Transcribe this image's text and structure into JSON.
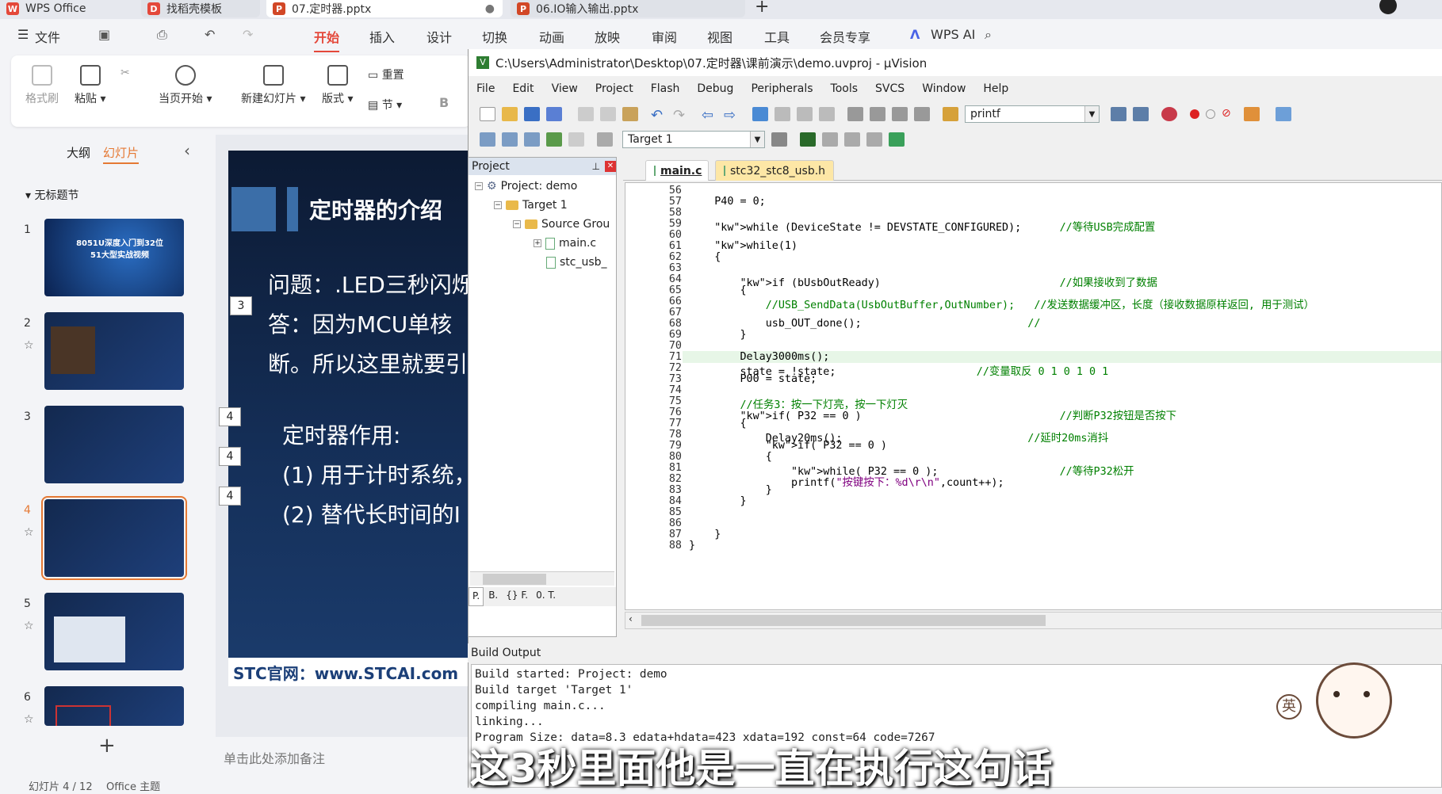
{
  "wps": {
    "tabs": [
      {
        "label": "WPS Office",
        "icon": "wps-logo-icon",
        "color": "#e4483a"
      },
      {
        "label": "找稻壳模板",
        "icon": "docer-icon",
        "color": "#e4483a"
      },
      {
        "label": "07.定时器.pptx",
        "icon": "ppt-file-icon",
        "color": "#d24726"
      },
      {
        "label": "06.IO输入输出.pptx",
        "icon": "ppt-file-icon",
        "color": "#d24726"
      }
    ],
    "menu": {
      "file": "文件",
      "tabs": [
        "开始",
        "插入",
        "设计",
        "切换",
        "动画",
        "放映",
        "审阅",
        "视图",
        "工具",
        "会员专享"
      ],
      "active_tab": "开始",
      "wps_ai": "WPS AI"
    },
    "ribbon": {
      "format_painter": "格式刷",
      "paste": "粘贴",
      "from_current": "当页开始",
      "new_slide": "新建幻灯片",
      "layout": "版式",
      "reset": "重置",
      "section": "节",
      "bold": "B"
    },
    "panel": {
      "outline_tab": "大纲",
      "slides_tab": "幻灯片",
      "section_title": "无标题节",
      "thumb1_title": "8051U深度入门到32位\n51大型实战视频",
      "thumbs": [
        {
          "num": "1",
          "star": false
        },
        {
          "num": "2",
          "star": true
        },
        {
          "num": "3",
          "star": false
        },
        {
          "num": "4",
          "star": true,
          "selected": true
        },
        {
          "num": "5",
          "star": true
        },
        {
          "num": "6",
          "star": true
        }
      ],
      "add_label": "+"
    },
    "slide": {
      "title": "定时器的介绍",
      "q_line": "问题：.LED三秒闪烁",
      "a_line1": "答：因为MCU单核",
      "a_line2": "断。所以这里就要引",
      "role_title": "定时器作用:",
      "role1": "(1) 用于计时系统，",
      "role2": "(2) 替代长时间的I",
      "footer": "STC官网：www.STCAI.com",
      "anim_markers": [
        "3",
        "4",
        "4",
        "4"
      ]
    },
    "notes_placeholder": "单击此处添加备注",
    "status": {
      "slide_count": "幻灯片 4 / 12",
      "theme": "Office 主题"
    }
  },
  "uvision": {
    "title": "C:\\Users\\Administrator\\Desktop\\07.定时器\\课前演示\\demo.uvproj - µVision",
    "menu": [
      "File",
      "Edit",
      "View",
      "Project",
      "Flash",
      "Debug",
      "Peripherals",
      "Tools",
      "SVCS",
      "Window",
      "Help"
    ],
    "find_combo": "printf",
    "target_combo": "Target 1",
    "project_pane": {
      "title": "Project",
      "root": "Project: demo",
      "target": "Target 1",
      "group": "Source Grou",
      "files": [
        "main.c",
        "stc_usb_"
      ],
      "bottom_tabs": [
        "P.",
        "B.",
        "{} F.",
        "0. T."
      ]
    },
    "editor_tabs": [
      {
        "label": "main.c",
        "active": true
      },
      {
        "label": "stc32_stc8_usb.h",
        "active": false
      }
    ],
    "code": [
      {
        "n": "56",
        "t": ""
      },
      {
        "n": "57",
        "t": "    P40 = 0;"
      },
      {
        "n": "58",
        "t": ""
      },
      {
        "n": "59",
        "t": "    while (DeviceState != DEVSTATE_CONFIGURED);      //等待USB完成配置"
      },
      {
        "n": "60",
        "t": ""
      },
      {
        "n": "61",
        "t": "    while(1)"
      },
      {
        "n": "62",
        "t": "    {"
      },
      {
        "n": "63",
        "t": ""
      },
      {
        "n": "64",
        "t": "        if (bUsbOutReady)                            //如果接收到了数据"
      },
      {
        "n": "65",
        "t": "        {"
      },
      {
        "n": "66",
        "t": "            //USB_SendData(UsbOutBuffer,OutNumber);   //发送数据缓冲区，长度（接收数据原样返回, 用于测试）"
      },
      {
        "n": "67",
        "t": ""
      },
      {
        "n": "68",
        "t": "            usb_OUT_done();                          //"
      },
      {
        "n": "69",
        "t": "        }"
      },
      {
        "n": "70",
        "t": ""
      },
      {
        "n": "71",
        "t": "        Delay3000ms();"
      },
      {
        "n": "72",
        "t": "        state = !state;                      //变量取反 0 1 0 1 0 1"
      },
      {
        "n": "73",
        "t": "        P00 = state;"
      },
      {
        "n": "74",
        "t": ""
      },
      {
        "n": "75",
        "t": "        //任务3：按一下灯亮，按一下灯灭"
      },
      {
        "n": "76",
        "t": "        if( P32 == 0 )                               //判断P32按钮是否按下"
      },
      {
        "n": "77",
        "t": "        {"
      },
      {
        "n": "78",
        "t": "            Delay20ms();                             //延时20ms消抖"
      },
      {
        "n": "79",
        "t": "            if( P32 == 0 )"
      },
      {
        "n": "80",
        "t": "            {"
      },
      {
        "n": "81",
        "t": "                while( P32 == 0 );                   //等待P32松开"
      },
      {
        "n": "82",
        "t": "                printf(\"按键按下：%d\\r\\n\",count++);"
      },
      {
        "n": "83",
        "t": "            }"
      },
      {
        "n": "84",
        "t": "        }"
      },
      {
        "n": "85",
        "t": ""
      },
      {
        "n": "86",
        "t": ""
      },
      {
        "n": "87",
        "t": "    }"
      },
      {
        "n": "88",
        "t": "}"
      }
    ],
    "build_title": "Build Output",
    "build_lines": [
      "Build started: Project: demo",
      "Build target 'Target 1'",
      "compiling main.c...",
      "linking...",
      "Program Size: data=8.3 edata+hdata=423 xdata=192 const=64 code=7267"
    ]
  },
  "subtitle": "这3秒里面他是一直在执行这句话",
  "ime_label": "英",
  "colors": {
    "accent": "#e4483a",
    "selected_slide": "#e57934",
    "comment": "#008000",
    "keyword": "#0000ff"
  }
}
